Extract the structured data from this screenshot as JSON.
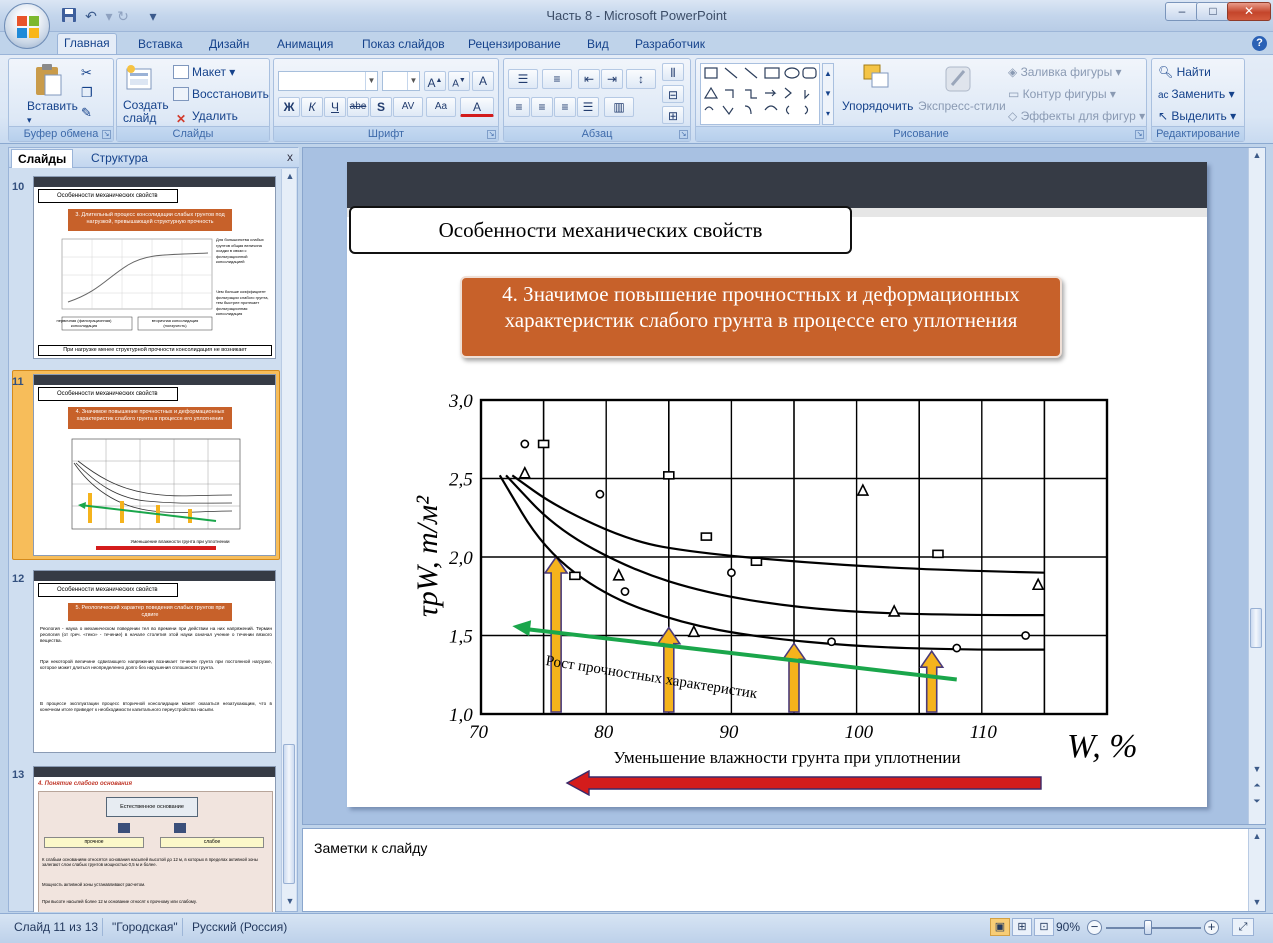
{
  "window": {
    "title": "Часть 8 - Microsoft PowerPoint",
    "buttons": {
      "minimize": "–",
      "maximize": "□",
      "close": "✕"
    }
  },
  "quick_access": {
    "save": "save-icon",
    "undo": "undo-icon",
    "redo": "redo-icon",
    "customize": "▾"
  },
  "tabs": [
    "Главная",
    "Вставка",
    "Дизайн",
    "Анимация",
    "Показ слайдов",
    "Рецензирование",
    "Вид",
    "Разработчик"
  ],
  "active_tab": "Главная",
  "help": "?",
  "ribbon": {
    "clipboard": {
      "label": "Буфер обмена",
      "paste": "Вставить"
    },
    "slides": {
      "label": "Слайды",
      "new_slide": "Создать слайд",
      "layout": "Макет",
      "reset": "Восстановить",
      "delete": "Удалить"
    },
    "font": {
      "label": "Шрифт",
      "font_name": "",
      "font_size": "",
      "bold": "Ж",
      "italic": "К",
      "underline": "Ч",
      "strike": "abe",
      "shadow": "S",
      "spacing": "AV",
      "case": "Aa",
      "grow": "A",
      "shrink": "A",
      "clear": "A",
      "color": "A"
    },
    "paragraph": {
      "label": "Абзац"
    },
    "drawing": {
      "label": "Рисование",
      "arrange": "Упорядочить",
      "quick_styles": "Экспресс-стили",
      "fill": "Заливка фигуры",
      "outline": "Контур фигуры",
      "effects": "Эффекты для фигур"
    },
    "editing": {
      "label": "Редактирование",
      "find": "Найти",
      "replace": "Заменить",
      "select": "Выделить"
    }
  },
  "left_panel": {
    "tabs": [
      "Слайды",
      "Структура"
    ],
    "close": "x",
    "thumbnails": [
      {
        "number": "10",
        "header": "Особенности механических свойств",
        "banner": "3. Длительный процесс консолидации слабых грунтов под нагрузкой, превышающей структурную прочность",
        "bottom": "При нагрузке менее структурной прочности консолидация не возникает",
        "side_text": [
          "Для большинства слабых грунтов общая величина осадки в связи с фильтрационной консолидацией",
          "Чем больше коэффициент фильтрации слабого грунта, тем быстрее протекает фильтрационная консолидация"
        ],
        "legend_a": "первичная (фильтрационная) консолидация",
        "legend_b": "вторичная консолидация (ползучесть)"
      },
      {
        "number": "11",
        "header": "Особенности механических свойств",
        "banner": "4. Значимое повышение прочностных и деформационных характеристик слабого грунта в процессе его уплотнения",
        "bottom": "Уменьшение влажности грунта при уплотнении"
      },
      {
        "number": "12",
        "header": "Особенности механических свойств",
        "banner": "5. Реологический характер поведения слабых грунтов при сдвиге",
        "paragraphs": [
          "Реология - наука о механическом поведении тел во времени при действии на них напряжений. Термин реология (от греч. «теко» - течение) в начале столетия этой науки означал учение о течении вязкого вещества.",
          "При некоторой величине сдвигающего напряжения возникает течение грунта при постоянной нагрузке, которое может длиться неопределенно долго без нарушения сплошности грунта.",
          "В процессе эксплуатации процесс вторичной консолидации может оказаться незатухающим, что в конечном итоге приведет к необходимости капитального переустройства насыпи."
        ]
      },
      {
        "number": "13",
        "header": "4. Понятие слабого основания",
        "box_main": "Естественное основание",
        "box_left": "прочное",
        "box_right": "слабое",
        "paragraphs": [
          "К слабым основаниям относятся основания насыпей высотой до 12 м, в которых в пределах активной зоны залегают слои слабых грунтов мощностью 0,5 м и более.",
          "Мощность активной зоны устанавливают расчетом.",
          "При высоте насыпей более 12 м основание относят к прочному или слабому."
        ]
      }
    ]
  },
  "slide": {
    "header": "Особенности механических свойств",
    "banner": "4. Значимое повышение прочностных и деформационных характеристик слабого грунта в процессе его уплотнения",
    "trend_label": "Рост прочностных характеристик",
    "bottom_label": "Уменьшение влажности грунта при уплотнении"
  },
  "chart_data": {
    "type": "line",
    "xlabel": "W, %",
    "ylabel": "τpW, т/м²",
    "xlim": [
      70,
      120
    ],
    "ylim": [
      1.0,
      3.0
    ],
    "x_ticks": [
      "70",
      "80",
      "90",
      "100",
      "110"
    ],
    "y_ticks": [
      "1,0",
      "1,5",
      "2,0",
      "2,5",
      "3,0"
    ],
    "grid": true,
    "series": [
      {
        "marker": "square",
        "x": [
          72.5,
          76,
          82,
          87,
          95,
          103,
          110,
          115
        ],
        "y": [
          2.52,
          2.32,
          2.1,
          2.03,
          1.97,
          1.93,
          1.91,
          1.9
        ]
      },
      {
        "marker": "triangle",
        "x": [
          72,
          76,
          82,
          88,
          95,
          102,
          110,
          115
        ],
        "y": [
          2.52,
          2.18,
          1.92,
          1.77,
          1.68,
          1.64,
          1.63,
          1.63
        ]
      },
      {
        "marker": "circle",
        "x": [
          71.5,
          75,
          80,
          86,
          92,
          100,
          108,
          115
        ],
        "y": [
          2.52,
          2.05,
          1.75,
          1.58,
          1.49,
          1.43,
          1.41,
          1.41
        ]
      }
    ],
    "points": [
      {
        "marker": "circle",
        "x": [
          73.5,
          79.5,
          81.5,
          90,
          98,
          108,
          113.5
        ],
        "y": [
          2.72,
          2.4,
          1.78,
          1.9,
          1.46,
          1.42,
          1.5
        ]
      },
      {
        "marker": "square",
        "x": [
          75,
          77.5,
          85,
          88,
          92,
          106.5
        ],
        "y": [
          2.72,
          1.88,
          2.52,
          2.13,
          1.97,
          2.02
        ]
      },
      {
        "marker": "triangle",
        "x": [
          73.5,
          81,
          87,
          100.5,
          103,
          114.5
        ],
        "y": [
          2.53,
          1.88,
          1.52,
          2.42,
          1.65,
          1.82
        ]
      }
    ],
    "up_arrows_x": [
      76,
      85,
      95,
      106
    ],
    "trend": {
      "from": {
        "x": 108,
        "y": 1.22
      },
      "to": {
        "x": 72.5,
        "y": 1.56
      }
    }
  },
  "notes": {
    "placeholder": "Заметки к слайду"
  },
  "status": {
    "slide_info": "Слайд 11 из 13",
    "theme": "\"Городская\"",
    "language": "Русский (Россия)",
    "zoom_text": "90%",
    "zoom_percent": 90
  },
  "colors": {
    "banner": "#c7612a",
    "slide_header_band": "#363b45",
    "arrow_up": "#f5b31c",
    "trend_arrow": "#1aa64b",
    "bottom_arrow": "#d41c1c",
    "selection": "#f7bd5a"
  }
}
